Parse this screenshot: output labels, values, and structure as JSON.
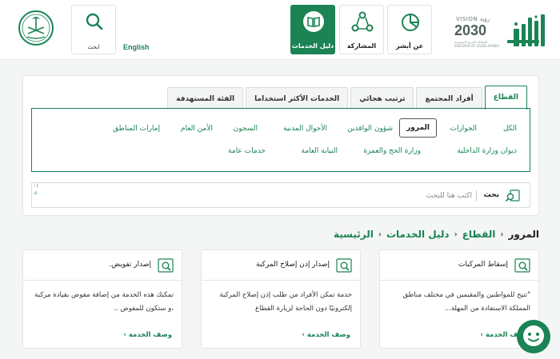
{
  "header": {
    "vision": {
      "line1": "VISION رؤية",
      "line2": "2030",
      "line3": "المملكة العربية السعودية KINGDOM OF SAUDI ARABIA"
    },
    "nav": [
      {
        "label": "عن أبشر",
        "icon": "chart-pie-icon"
      },
      {
        "label": "المشاركة",
        "icon": "share-nodes-icon"
      },
      {
        "label": "دليل الخدمات",
        "icon": "book-icon",
        "active": true
      }
    ],
    "search_label": "ابحث",
    "language": "English"
  },
  "filters": {
    "tabs": [
      "القطاع",
      "أفراد المجتمع",
      "ترتيب هجائي",
      "الخدمات الأكثر استخداما",
      "الفئة المستهدفة"
    ],
    "chips_row1": [
      "الكل",
      "الجوازات",
      "المرور",
      "شؤون الوافدين",
      "الأحوال المدنية",
      "السجون",
      "الأمن العام",
      "إمارات المناطق"
    ],
    "chips_row2": [
      "ديوان وزارة الداخلية",
      "وزارة الحج والعمرة",
      "النيابة العامة",
      "خدمات عامة"
    ],
    "search": {
      "label": "بحث",
      "placeholder": "اكتب هنا للبحث",
      "edge": "ا ؛ ى"
    }
  },
  "breadcrumb": [
    "الرئيسية",
    "دليل الخدمات",
    "القطاع",
    "المرور"
  ],
  "cards": [
    {
      "title": "إسقاط المركبات",
      "description": "\"تتيح للمواطنين والمقيمين في مختلف مناطق المملكة الاستفادة من المهلة...",
      "link": "وصف الخدمة"
    },
    {
      "title": "إصدار إذن إصلاح المركبة",
      "description": "خدمة تمكن الأفراد من طلب إذن إصلاح المركبة إلكترونيًا دون الحاجة لزيارة القطاع",
      "link": "وصف الخدمة"
    },
    {
      "title": "إصدار تفويض.",
      "description": "تمكنك هذه الخدمة من إضافة مفوض بقيادة مركبة ،و ستكون للمفوض ..",
      "link": "وصف الخدمة"
    }
  ],
  "colors": {
    "brand": "#1b8354",
    "text": "#222222"
  }
}
